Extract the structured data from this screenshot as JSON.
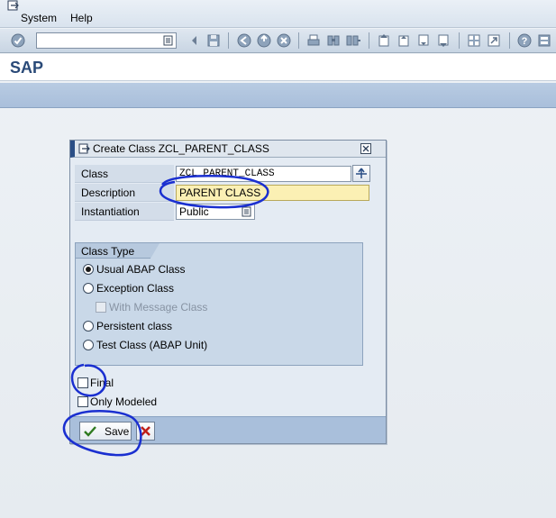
{
  "menubar": {
    "items": [
      {
        "label": "System"
      },
      {
        "label": "Help"
      }
    ]
  },
  "toolbar": {
    "command_field_value": ""
  },
  "titlebar": {
    "title": "SAP"
  },
  "dialog": {
    "title": "Create Class ZCL_PARENT_CLASS",
    "fields": {
      "class": {
        "label": "Class",
        "value": "ZCL_PARENT_CLASS"
      },
      "description": {
        "label": "Description",
        "value": "PARENT CLASS"
      },
      "instantiation": {
        "label": "Instantiation",
        "value": "Public"
      }
    },
    "class_type": {
      "title": "Class Type",
      "options": [
        {
          "label": "Usual ABAP Class",
          "selected": true
        },
        {
          "label": "Exception Class",
          "selected": false
        },
        {
          "label": "With Message Class",
          "checked": false,
          "disabled": true
        },
        {
          "label": "Persistent class",
          "selected": false
        },
        {
          "label": "Test Class (ABAP Unit)",
          "selected": false
        }
      ]
    },
    "final": {
      "label": "Final",
      "checked": false
    },
    "only_modeled": {
      "label": "Only Modeled",
      "checked": false
    },
    "save_label": "Save"
  },
  "colors": {
    "annotation": "#1a2fd0",
    "required_field": "#fbf0b4",
    "title_text": "#2a4a78"
  }
}
